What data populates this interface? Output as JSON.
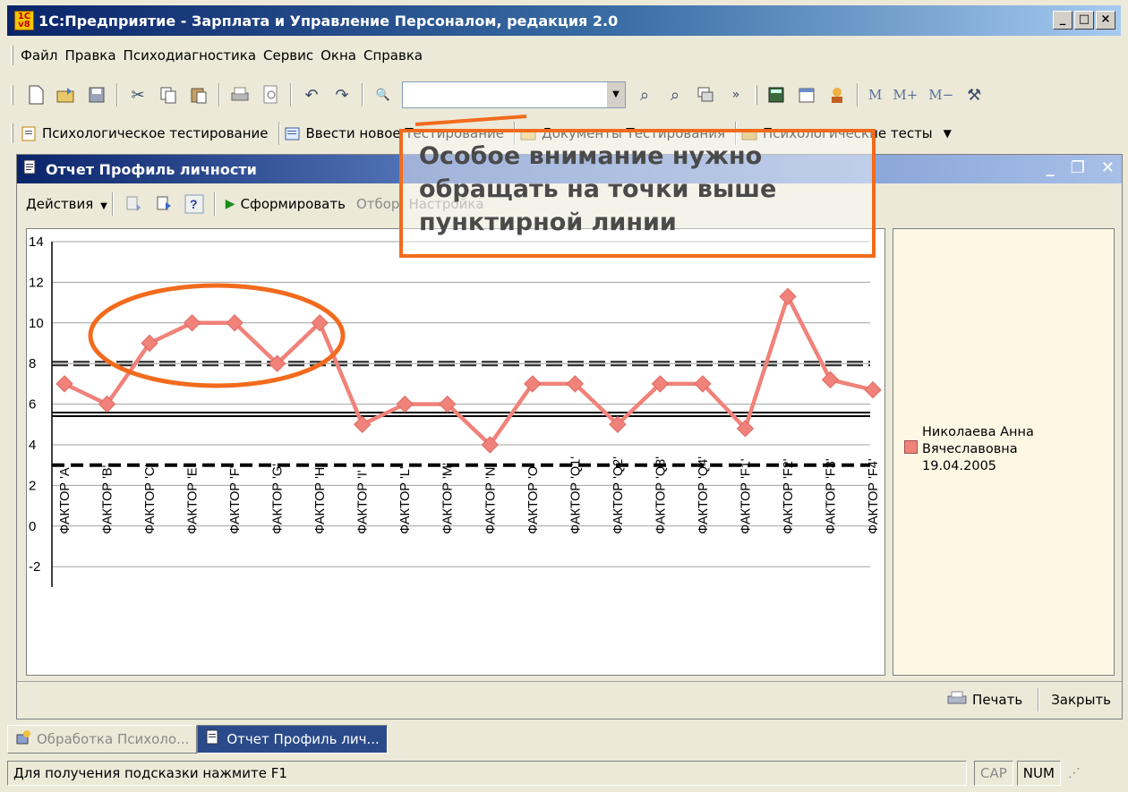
{
  "window": {
    "title": "1С:Предприятие - Зарплата и Управление Персоналом, редакция 2.0",
    "app_icon": "1C",
    "buttons": [
      "minimize",
      "maximize",
      "close"
    ]
  },
  "menu": [
    "Файл",
    "Правка",
    "Психодиагностика",
    "Сервис",
    "Окна",
    "Справка"
  ],
  "toolbar": {
    "search_value": "",
    "m_buttons": [
      "M",
      "M+",
      "M−"
    ]
  },
  "toolbar2": {
    "items": [
      "Психологическое тестирование",
      "Ввести новое Тестирование",
      "Документы Тестирования",
      "Психологические тесты"
    ]
  },
  "report": {
    "title": "Отчет  Профиль личности",
    "actions_label": "Действия",
    "generate_label": "Сформировать",
    "filter_label": "Отбор",
    "settings_label": "Настройка",
    "print_label": "Печать",
    "close_label": "Закрыть"
  },
  "chart_data": {
    "type": "line",
    "categories": [
      "ФАКТОР 'A'",
      "ФАКТОР 'B'",
      "ФАКТОР 'C'",
      "ФАКТОР 'E'",
      "ФАКТОР 'F'",
      "ФАКТОР 'G'",
      "ФАКТОР 'H'",
      "ФАКТОР 'I'",
      "ФАКТОР 'L'",
      "ФАКТОР 'M'",
      "ФАКТОР 'N'",
      "ФАКТОР 'O'",
      "ФАКТОР 'Q1'",
      "ФАКТОР 'Q2'",
      "ФАКТОР 'Q3'",
      "ФАКТОР 'Q4'",
      "ФАКТОР 'F1'",
      "ФАКТОР 'F2'",
      "ФАКТОР 'F3'",
      "ФАКТОР 'F4'"
    ],
    "series": [
      {
        "name": "Николаева Анна Вячеславовна 19.04.2005",
        "values": [
          7,
          6,
          9,
          10,
          10,
          8,
          10,
          5,
          6,
          6,
          4,
          7,
          7,
          5,
          7,
          7,
          4.8,
          11.3,
          7.2,
          6.7
        ],
        "color": "#f0827a"
      }
    ],
    "reference_lines": [
      8,
      5.5,
      3
    ],
    "ylim": [
      -3,
      14
    ],
    "yticks": [
      -2,
      0,
      2,
      4,
      6,
      8,
      10,
      12,
      14
    ],
    "grid": true,
    "legend": "right"
  },
  "legend": {
    "line1": "Николаева Анна",
    "line2": "Вячеславовна",
    "line3": "19.04.2005"
  },
  "callout": {
    "line1": "Особое внимание нужно",
    "line2": "обращать на точки выше",
    "line3": "пунктирной линии",
    "color": "#f26b1d"
  },
  "taskbar": [
    "Обработка  Психоло...",
    "Отчет  Профиль лич..."
  ],
  "status": {
    "hint": "Для получения подсказки нажмите F1",
    "cap": "CAP",
    "num": "NUM"
  }
}
